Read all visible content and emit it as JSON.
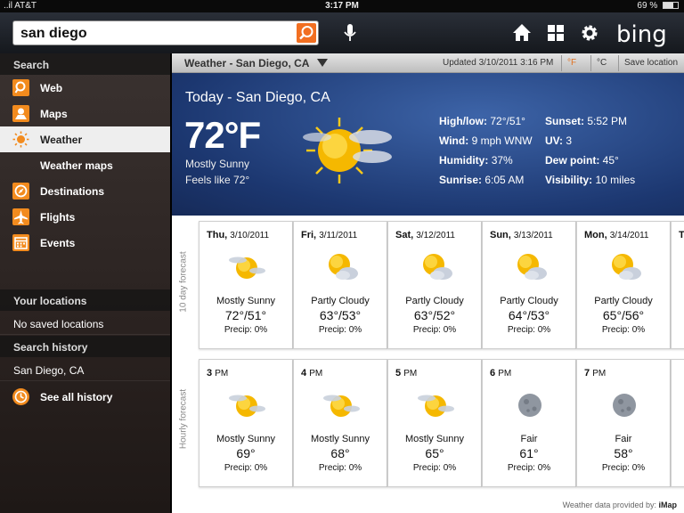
{
  "status_bar": {
    "carrier": "..il AT&T",
    "time": "3:17 PM",
    "battery": "69 %",
    "battery_level": 0.69
  },
  "search": {
    "value": "san diego"
  },
  "brand": {
    "logo": "bing",
    "accent": "#f26f21"
  },
  "toolbar_icons": [
    "microphone-icon",
    "home-icon",
    "grid-icon",
    "gear-icon"
  ],
  "sidebar": {
    "search_header": "Search",
    "items": [
      {
        "label": "Web",
        "icon": "search-icon"
      },
      {
        "label": "Maps",
        "icon": "map-pin-icon"
      },
      {
        "label": "Weather",
        "icon": "sun-icon"
      },
      {
        "label": "Weather maps",
        "icon": ""
      },
      {
        "label": "Destinations",
        "icon": "compass-icon"
      },
      {
        "label": "Flights",
        "icon": "plane-icon"
      },
      {
        "label": "Events",
        "icon": "calendar-icon"
      }
    ],
    "locations_header": "Your locations",
    "no_locations": "No saved locations",
    "history_header": "Search history",
    "history_item": "San Diego, CA",
    "see_all": "See all history"
  },
  "titlebar": {
    "title": "Weather - San Diego, CA",
    "updated": "Updated 3/10/2011 3:16 PM",
    "unit_f": "°F",
    "unit_c": "°C",
    "save": "Save location"
  },
  "current": {
    "heading": "Today - San Diego, CA",
    "temp": "72°F",
    "condition": "Mostly Sunny",
    "feels": "Feels like 72°",
    "stats": [
      {
        "label": "High/low:",
        "value": "72°/51°"
      },
      {
        "label": "Wind:",
        "value": "9 mph WNW"
      },
      {
        "label": "Humidity:",
        "value": "37%"
      },
      {
        "label": "Sunrise:",
        "value": "6:05 AM"
      },
      {
        "label": "Sunset:",
        "value": "5:52 PM"
      },
      {
        "label": "UV:",
        "value": "3"
      },
      {
        "label": "Dew point:",
        "value": "45°"
      },
      {
        "label": "Visibility:",
        "value": "10 miles"
      }
    ]
  },
  "forecast_label": "10 day forecast",
  "daily": [
    {
      "day": "Thu,",
      "date": "3/10/2011",
      "condition": "Mostly Sunny",
      "temp": "72°/51°",
      "precip": "Precip: 0%",
      "icon": "mostly-sunny-icon"
    },
    {
      "day": "Fri,",
      "date": "3/11/2011",
      "condition": "Partly Cloudy",
      "temp": "63°/53°",
      "precip": "Precip: 0%",
      "icon": "partly-cloudy-icon"
    },
    {
      "day": "Sat,",
      "date": "3/12/2011",
      "condition": "Partly Cloudy",
      "temp": "63°/52°",
      "precip": "Precip: 0%",
      "icon": "partly-cloudy-icon"
    },
    {
      "day": "Sun,",
      "date": "3/13/2011",
      "condition": "Partly Cloudy",
      "temp": "64°/53°",
      "precip": "Precip: 0%",
      "icon": "partly-cloudy-icon"
    },
    {
      "day": "Mon,",
      "date": "3/14/2011",
      "condition": "Partly Cloudy",
      "temp": "65°/56°",
      "precip": "Precip: 0%",
      "icon": "partly-cloudy-icon"
    },
    {
      "day": "Tu",
      "date": "",
      "condition": "",
      "temp": "",
      "precip": "",
      "icon": ""
    }
  ],
  "hourly_label": "Hourly forecast",
  "hourly": [
    {
      "hour": "3",
      "ampm": "PM",
      "condition": "Mostly Sunny",
      "temp": "69°",
      "precip": "Precip: 0%",
      "icon": "mostly-sunny-icon"
    },
    {
      "hour": "4",
      "ampm": "PM",
      "condition": "Mostly Sunny",
      "temp": "68°",
      "precip": "Precip: 0%",
      "icon": "mostly-sunny-icon"
    },
    {
      "hour": "5",
      "ampm": "PM",
      "condition": "Mostly Sunny",
      "temp": "65°",
      "precip": "Precip: 0%",
      "icon": "mostly-sunny-icon"
    },
    {
      "hour": "6",
      "ampm": "PM",
      "condition": "Fair",
      "temp": "61°",
      "precip": "Precip: 0%",
      "icon": "moon-icon"
    },
    {
      "hour": "7",
      "ampm": "PM",
      "condition": "Fair",
      "temp": "58°",
      "precip": "Precip: 0%",
      "icon": "moon-icon"
    },
    {
      "hour": "",
      "ampm": "",
      "condition": "",
      "temp": "",
      "precip": "",
      "icon": ""
    }
  ],
  "credit": {
    "text": "Weather data provided by:",
    "provider": "iMap"
  }
}
